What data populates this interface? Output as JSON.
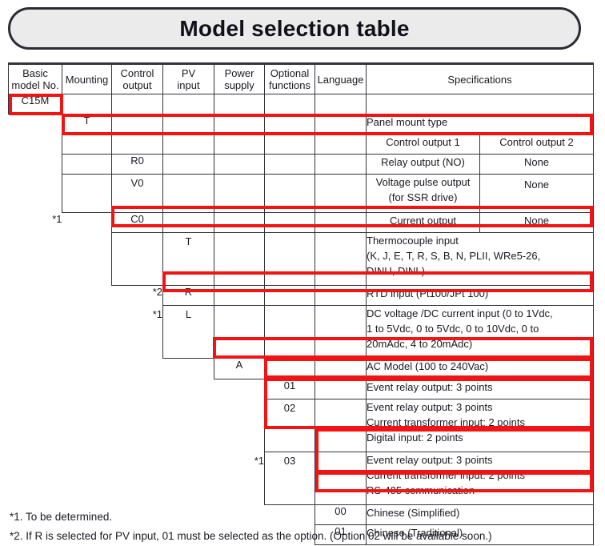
{
  "title": "Model selection table",
  "table": {
    "headers": [
      "Basic model No.",
      "Mounting",
      "Control output",
      "PV input",
      "Power supply",
      "Optional functions",
      "Language",
      "Specifications"
    ],
    "headers_split": [
      "Basic",
      "model No.",
      "Mounting",
      "Control",
      "output",
      "PV",
      "input",
      "Power",
      "supply",
      "Optional",
      "functions",
      "Language",
      "Specifications"
    ],
    "spec_subheaders": {
      "output1": "Control output 1",
      "output2": "Control output 2"
    },
    "rows": {
      "basic_model": {
        "code": "C15M"
      },
      "mounting": {
        "code": "T",
        "spec": "Panel mount type"
      },
      "control_output": [
        {
          "note": "",
          "code": "R0",
          "out1": "Relay output (NO)",
          "out2": "None"
        },
        {
          "note": "",
          "code": "V0",
          "out1_line1": "Voltage pulse output",
          "out1_line2": "(for SSR drive)",
          "out2": "None"
        },
        {
          "note": "*1",
          "code": "C0",
          "out1": "Current output",
          "out2": "None"
        }
      ],
      "pv_input": [
        {
          "note": "",
          "code": "T",
          "spec_lines": [
            "Thermocouple input",
            "(K, J, E, T, R, S, B, N, PLII, WRe5-26,",
            "DINU, DINL)"
          ]
        },
        {
          "note": "*2",
          "code": "R",
          "spec_lines": [
            "RTD input (Pt100/JPt 100)"
          ]
        },
        {
          "note": "*1",
          "code": "L",
          "spec_lines": [
            "DC voltage /DC current input (0 to 1Vdc,",
            "1 to 5Vdc, 0 to 5Vdc, 0 to 10Vdc, 0 to",
            "20mAdc, 4 to 20mAdc)"
          ]
        }
      ],
      "power_supply": [
        {
          "note": "",
          "code": "A",
          "spec_lines": [
            "AC Model (100 to 240Vac)"
          ]
        }
      ],
      "optional_functions": [
        {
          "note": "",
          "code": "01",
          "spec_lines": [
            "Event relay output: 3 points"
          ]
        },
        {
          "note": "",
          "code": "02",
          "spec_lines": [
            "Event relay output: 3 points",
            "Current transformer input: 2 points",
            "Digital input: 2 points"
          ]
        },
        {
          "note": "*1",
          "code": "03",
          "spec_lines": [
            "Event relay output: 3 points",
            "Current transformer input: 2 points",
            "RS-485 communication"
          ]
        }
      ],
      "language": [
        {
          "code": "00",
          "spec": "Chinese (Simplified)"
        },
        {
          "code": "01",
          "spec": "Chinese (Traditional)"
        }
      ]
    }
  },
  "footnotes": [
    "*1. To be determined.",
    "*2. If R is selected for PV input, 01 must be selected as the option. (Option 02 will be available soon.)"
  ],
  "colors": {
    "highlight": "#f01414",
    "banner_fill": "#ebebeb",
    "border": "#33333b"
  }
}
